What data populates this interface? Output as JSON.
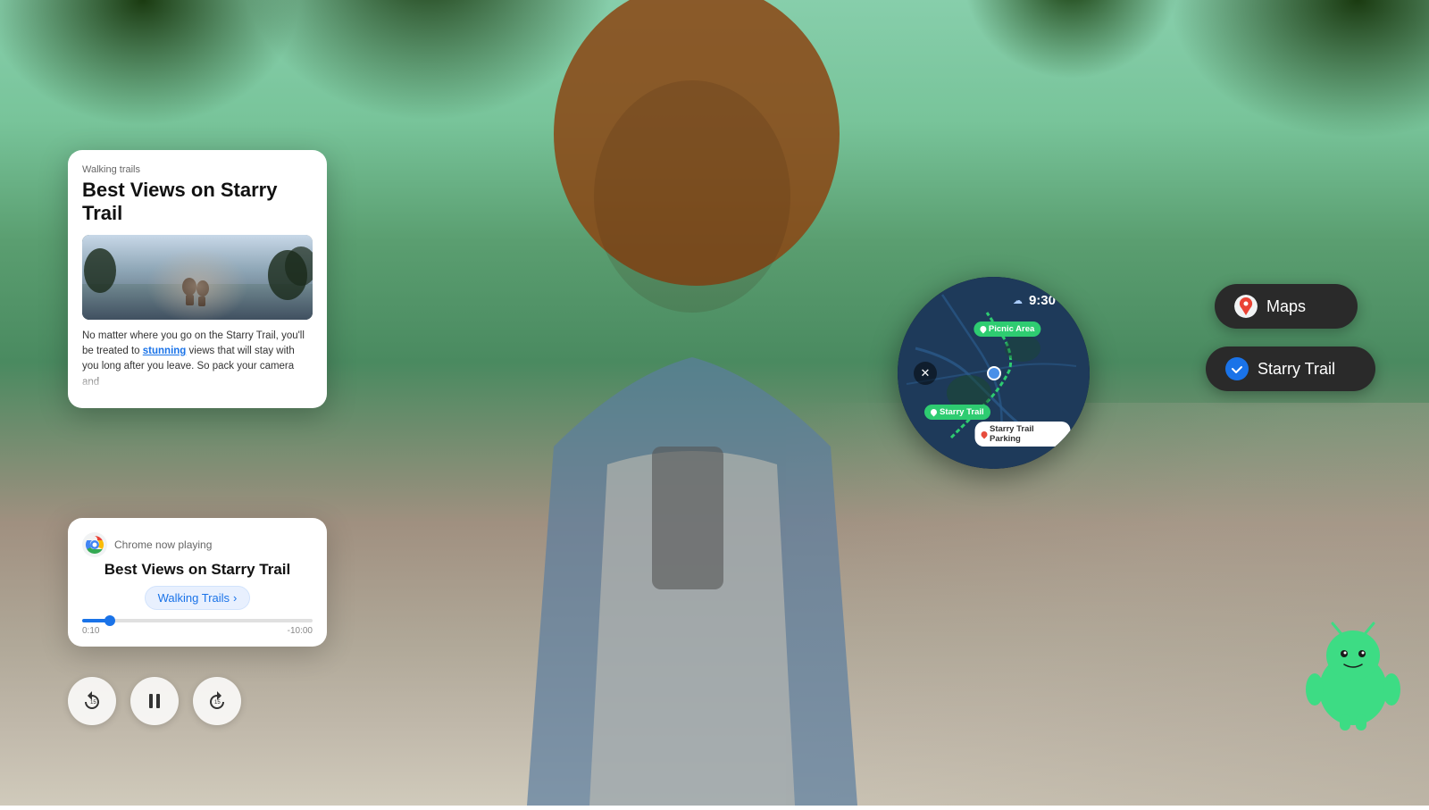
{
  "background": {
    "description": "Outdoor park scene with woman holding smartphone"
  },
  "article_card": {
    "category": "Walking trails",
    "title": "Best Views on Starry Trail",
    "body_text": "No matter where you go on the Starry Trail, you'll be treated to stunning views that will stay with you long after you leave. So pack your camera and",
    "body_highlight": "stunning",
    "image_alt": "Two people sitting on trail overlooking scenic view"
  },
  "media_player": {
    "chrome_label": "Chrome now playing",
    "title": "Best Views on Starry Trail",
    "tag_label": "Walking Trails",
    "tag_arrow": "›",
    "time_current": "0:10",
    "time_remaining": "-10:00",
    "progress_percent": 12
  },
  "media_controls": {
    "rewind_label": "⟳",
    "pause_label": "⏸",
    "forward_label": "⟳"
  },
  "watch": {
    "time": "9:30",
    "weather_icon": "☁",
    "labels": {
      "picnic": "Picnic Area",
      "starry": "Starry Trail",
      "parking": "Starry Trail Parking"
    }
  },
  "pills": {
    "maps_label": "Maps",
    "starry_trail_label": "Starry Trail"
  },
  "android": {
    "color": "#3ddc84",
    "eye_color": "#1a1a1a"
  }
}
